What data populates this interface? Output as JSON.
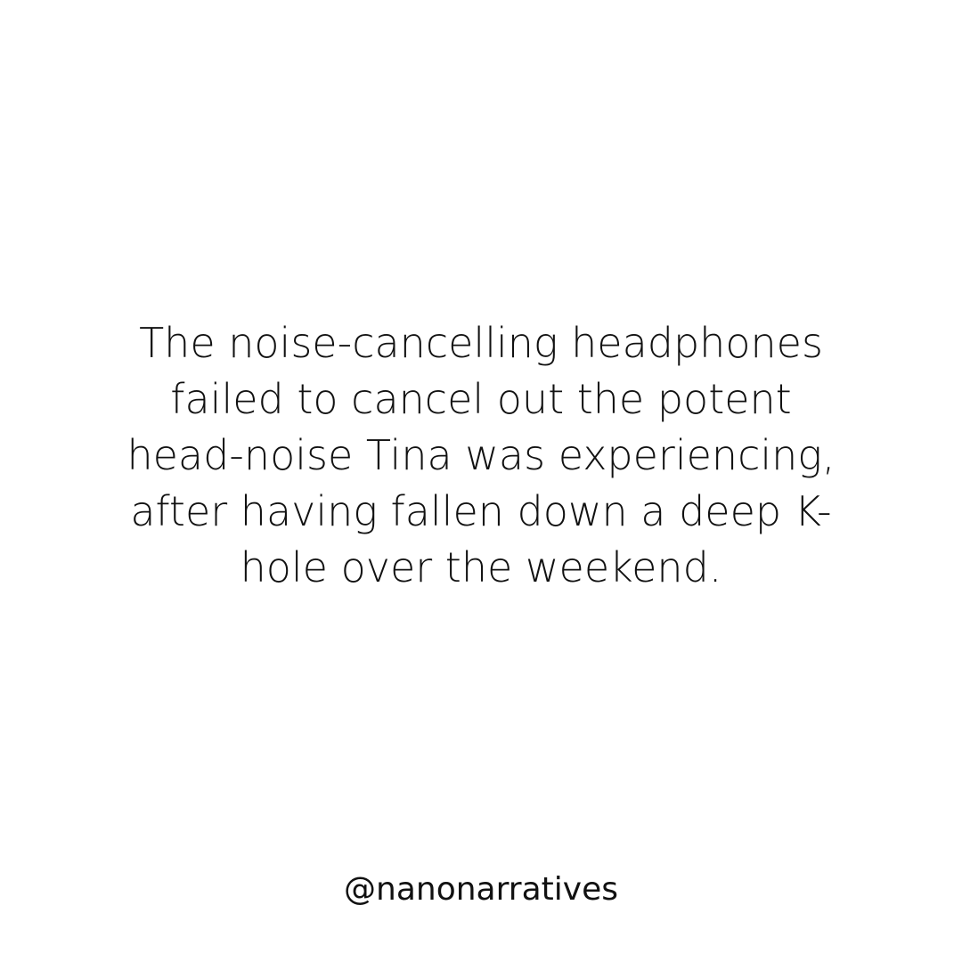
{
  "post": {
    "lines": [
      "The noise-cancelling headphones",
      "failed to cancel out the potent",
      "head-noise Tina was experiencing,",
      "after having fallen down a deep K-",
      "hole over the weekend."
    ],
    "handle": "@nanonarratives"
  },
  "colors": {
    "background": "#ffffff",
    "text": "#111111"
  }
}
